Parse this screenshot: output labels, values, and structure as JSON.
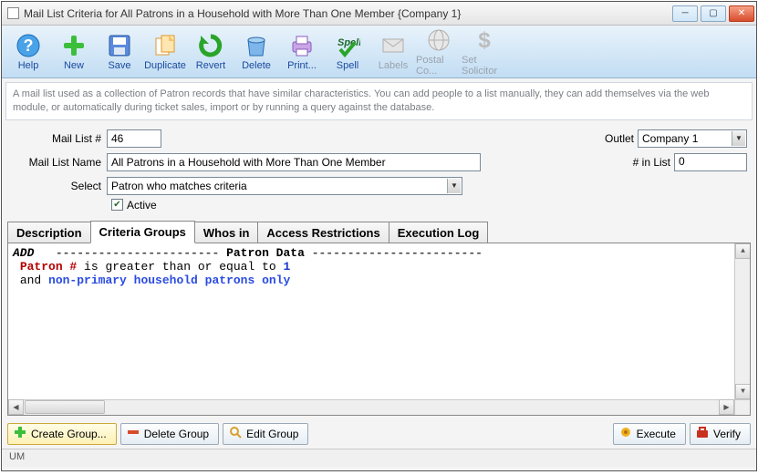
{
  "window": {
    "title": "Mail List Criteria for All Patrons in a Household with More Than One Member {Company 1}"
  },
  "toolbar": [
    {
      "name": "help",
      "label": "Help",
      "disabled": false
    },
    {
      "name": "new",
      "label": "New",
      "disabled": false
    },
    {
      "name": "save",
      "label": "Save",
      "disabled": false
    },
    {
      "name": "duplicate",
      "label": "Duplicate",
      "disabled": false
    },
    {
      "name": "revert",
      "label": "Revert",
      "disabled": false
    },
    {
      "name": "delete",
      "label": "Delete",
      "disabled": false
    },
    {
      "name": "print",
      "label": "Print...",
      "disabled": false
    },
    {
      "name": "spell",
      "label": "Spell",
      "disabled": false
    },
    {
      "name": "labels",
      "label": "Labels",
      "disabled": true
    },
    {
      "name": "postalco",
      "label": "Postal Co...",
      "disabled": true
    },
    {
      "name": "setsolicitor",
      "label": "Set Solicitor",
      "disabled": true
    }
  ],
  "description": "A mail list used as a collection of Patron records that have similar characteristics.   You can add people to a list manually, they can add themselves via the web module, or automatically during ticket sales, import or by running a query against the database.",
  "form": {
    "mail_list_no_label": "Mail List #",
    "mail_list_no": "46",
    "outlet_label": "Outlet",
    "outlet": "Company 1",
    "mail_list_name_label": "Mail List Name",
    "mail_list_name": "All Patrons in a Household with More Than One Member",
    "num_in_list_label": "# in List",
    "num_in_list": "0",
    "select_label": "Select",
    "select_value": "Patron who matches criteria",
    "active_label": "Active",
    "active_checked": true
  },
  "tabs": [
    "Description",
    "Criteria Groups",
    "Whos in",
    "Access Restrictions",
    "Execution Log"
  ],
  "active_tab": "Criteria Groups",
  "criteria": {
    "add": "ADD",
    "header": "Patron Data",
    "line1_a": "Patron #",
    "line1_b": " is greater than or equal to ",
    "line1_c": "1",
    "line2_a": "and ",
    "line2_b": "non-primary household patrons only"
  },
  "buttons": {
    "create_group": "Create Group...",
    "delete_group": "Delete Group",
    "edit_group": "Edit Group",
    "execute": "Execute",
    "verify": "Verify"
  },
  "status": "UM"
}
